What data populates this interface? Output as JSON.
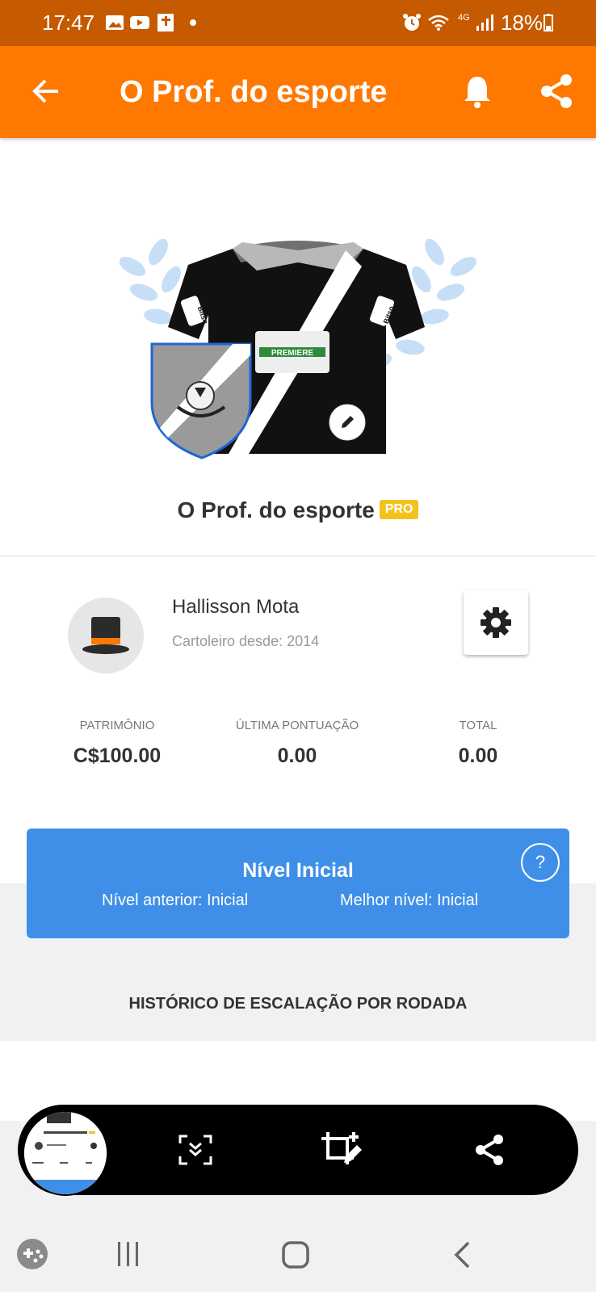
{
  "status_bar": {
    "time": "17:47",
    "battery": "18%",
    "network": "4G",
    "left_icons": [
      "gallery-icon",
      "youtube-icon",
      "bible-icon",
      "dot-icon"
    ],
    "right_icons": [
      "alarm-icon",
      "wifi-icon",
      "signal-icon",
      "battery-icon"
    ]
  },
  "app_bar": {
    "title": "O  Prof. do esporte",
    "icons": [
      "back-arrow-icon",
      "bell-icon",
      "share-icon"
    ],
    "color": "#ff7800"
  },
  "team": {
    "name": "O  Prof. do esporte",
    "badge": "PRO",
    "jersey_sponsor": "PREMIERE",
    "sleeve_sponsor": "Bitso"
  },
  "user": {
    "name": "Hallisson Mota",
    "since": "Cartoleiro desde: 2014"
  },
  "stats": [
    {
      "label": "PATRIMÔNIO",
      "value": "C$100.00"
    },
    {
      "label": "ÚLTIMA PONTUAÇÃO",
      "value": "0.00"
    },
    {
      "label": "TOTAL",
      "value": "0.00"
    }
  ],
  "level": {
    "title": "Nível Inicial",
    "previous": "Nível anterior: Inicial",
    "best": "Melhor nível: Inicial",
    "help": "?",
    "color": "#3f8fe8"
  },
  "history_title": "HISTÓRICO DE ESCALAÇÃO POR RODADA",
  "screenshot_toolbar": {
    "icons": [
      "scroll-capture-icon",
      "crop-edit-icon",
      "share-icon"
    ]
  },
  "nav_bar": {
    "icons": [
      "game-launcher-icon",
      "recents-icon",
      "home-icon",
      "back-icon"
    ]
  }
}
